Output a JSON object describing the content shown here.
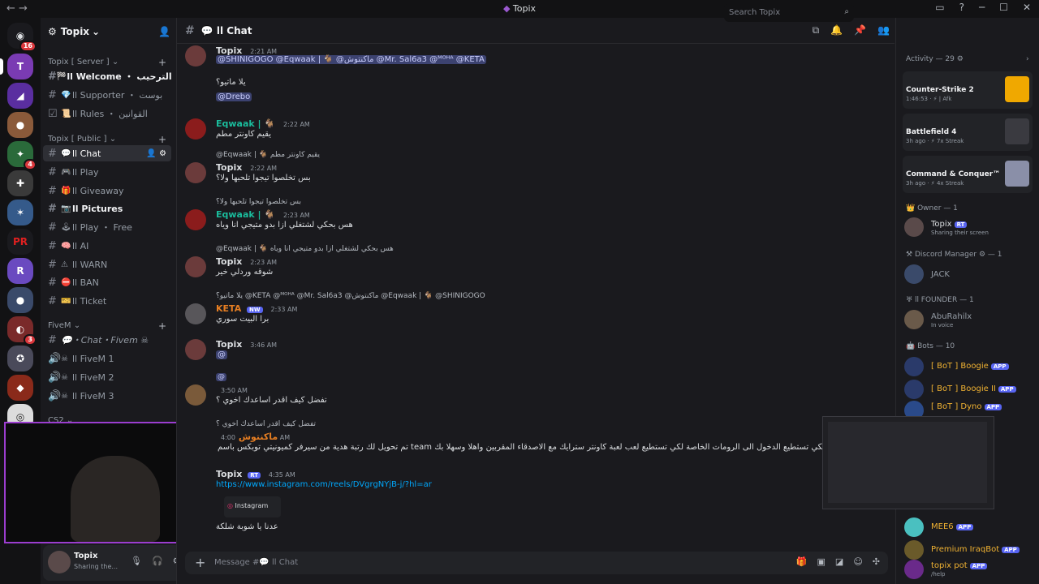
{
  "window": {
    "title": "Topix"
  },
  "server": {
    "name": "Topix",
    "chevron": "⌄"
  },
  "categories": [
    {
      "label": "Topix [ Server ]"
    },
    {
      "label": "Topix [ Public ]"
    },
    {
      "label": "FiveM"
    },
    {
      "label": "CS2"
    }
  ],
  "channels": [
    {
      "label": "ll Welcome ・ الترحيب",
      "icon": "flag-icon",
      "glyph": "🏁"
    },
    {
      "label": "ll Supporter ・ بوست",
      "icon": "gem-icon",
      "glyph": "💎"
    },
    {
      "label": "ll Rules ・ القوانين",
      "icon": "scroll-icon",
      "glyph": "📜"
    },
    {
      "label": "ll Chat",
      "icon": "speech-icon",
      "glyph": "💬"
    },
    {
      "label": "ll Play",
      "icon": "gamepad-icon",
      "glyph": "🎮"
    },
    {
      "label": "ll Giveaway",
      "icon": "gift-icon",
      "glyph": "🎁"
    },
    {
      "label": "ll Pictures",
      "icon": "camera-icon",
      "glyph": "📷"
    },
    {
      "label": "ll Play ・ Free",
      "icon": "joystick-icon",
      "glyph": "🕹"
    },
    {
      "label": "ll AI",
      "icon": "brain-icon",
      "glyph": "🧠"
    },
    {
      "label": "ll WARN",
      "icon": "warning-icon",
      "glyph": "⚠"
    },
    {
      "label": "ll BAN",
      "icon": "ban-icon",
      "glyph": "⛔"
    },
    {
      "label": "ll Ticket",
      "icon": "ticket-icon",
      "glyph": "🎫"
    },
    {
      "label": "💬・Chat・Fivem ☠",
      "icon": "speech-icon",
      "glyph": ""
    },
    {
      "label": "ll FiveM 1",
      "icon": "skull-icon",
      "glyph": "☠"
    },
    {
      "label": "ll FiveM 2",
      "icon": "skull-icon",
      "glyph": "☠"
    },
    {
      "label": "ll FiveM 3",
      "icon": "skull-icon",
      "glyph": "☠"
    }
  ],
  "user": {
    "name": "Topix",
    "status": "Sharing the..."
  },
  "header": {
    "channel": "💬 ll Chat",
    "search_placeholder": "Search Topix"
  },
  "messages": [
    {
      "author": "Topix",
      "time": "2:21 AM",
      "lines": [
        "@SHINIGOGO @Eqwaak | 🐐 @ماكنتوش @Mr. Sal6a3 @ᴹᴼᴴᴬ @KETA",
        "يلا ماتيو؟",
        "@Drebo"
      ]
    },
    {
      "author": "Eqwaak | 🐐",
      "time": "2:22 AM",
      "lines": [
        "يقيم كاونتر مطم"
      ]
    },
    {
      "author": "Topix",
      "time": "2:22 AM",
      "reply": "@Eqwaak | 🐐 يقيم كاونتر مطم",
      "lines": [
        "بس تخلصوا تيجوا تلحبها ولا؟"
      ]
    },
    {
      "author": "Eqwaak | 🐐",
      "time": "2:23 AM",
      "reply": "بس تخلصوا تيجوا تلحبها ولا؟",
      "lines": [
        "هس بحكي لشتغلي ازا بدو متيجي انا وياه"
      ]
    },
    {
      "author": "Topix",
      "time": "2:23 AM",
      "reply": "@Eqwaak | 🐐 هس بحكي لشتغلي ازا بدو متيجي انا وياه",
      "lines": [
        "شوقه وردلي خير"
      ]
    },
    {
      "author": "KETA",
      "badge": "NW",
      "time": "2:33 AM",
      "reply": "يلا ماتيو؟ @KETA @ᴹᴼᴴᴬ @Mr. Sal6a3 @ماكنتوش @Eqwaak | 🐐 @SHINIGOGO",
      "lines": [
        "برا البيت سوري"
      ]
    },
    {
      "author": "Topix",
      "time": "3:46 AM",
      "lines": [
        "@"
      ]
    },
    {
      "author": "",
      "time": "3:50 AM",
      "reply": "@",
      "lines": [
        "تفضل كيف اقدر اساعدك اخوي ؟"
      ]
    },
    {
      "author": "ماكنتوش",
      "time": "4:00 AM",
      "reply": "تفضل كيف اقدر اساعدك اخوي ؟",
      "lines": [
        "تم تحويل لك رتبة هدية من سيرفر كميونيتي توبكس باسم team لكي تستطيع الدخول الى الرومات الخاصة لكي تستطيع لعب لعبة كاونتر سترايك مع الاصدقاء المقربين واهلا وسهلا بك"
      ]
    },
    {
      "author": "Topix",
      "badge": "RT",
      "time": "4:35 AM",
      "lines": [
        "https://www.instagram.com/reels/DVgrgNYjB-j/?hl=ar",
        "Instagram",
        "عدنا يا شوبة شلكة"
      ]
    }
  ],
  "composer": {
    "placeholder": "Message #💬 ll Chat"
  },
  "activity": {
    "label": "Activity — 29"
  },
  "activity_cards": [
    {
      "game": "Counter-Strike 2",
      "sub": "1:46:53 · ⚡ | Afk",
      "color": "#f0a800"
    },
    {
      "game": "Battlefield 4",
      "sub": "3h ago · ⚡ 7x Streak",
      "color": "#3a3a40"
    },
    {
      "game": "Command & Conquer™ Gen...",
      "sub": "3h ago · ⚡ 4x Streak",
      "color": "#8a8fa8"
    }
  ],
  "roles": [
    {
      "label": "Owner — 1"
    },
    {
      "label": "Discord Manager ⚙ — 1"
    },
    {
      "label": "ll FOUNDER — 1"
    },
    {
      "label": "Bots — 10"
    }
  ],
  "members": [
    {
      "name": "Topix",
      "tag": "RT",
      "status": "Sharing their screen",
      "color": "#dbdee1"
    },
    {
      "name": "JACK",
      "tag": "",
      "status": "",
      "color": "#949ba4"
    },
    {
      "name": "AbuRahilx",
      "tag": "",
      "status": "In voice",
      "color": "#949ba4"
    },
    {
      "name": "[ BoT ] Boogie",
      "tag": "APP",
      "status": "",
      "color": "#f0b232"
    },
    {
      "name": "[ BoT ] Boogie II",
      "tag": "APP",
      "status": "",
      "color": "#f0b232"
    },
    {
      "name": "[ BoT ] Dyno",
      "tag": "APP",
      "status": "",
      "color": "#f0b232"
    },
    {
      "name": "MEE6",
      "tag": "APP",
      "status": "",
      "color": "#f0b232"
    },
    {
      "name": "Premium IraqBot",
      "tag": "APP",
      "status": "",
      "color": "#f0b232"
    },
    {
      "name": "topix pot",
      "tag": "APP",
      "status": "/help",
      "color": "#f0b232"
    }
  ],
  "guild_badges": {
    "home": "16",
    "g3": "4",
    "g10": "3"
  },
  "colors": {
    "accent": "#5865f2",
    "bg": "#1a1a1e",
    "rail": "#121214",
    "link": "#00a8fc"
  }
}
